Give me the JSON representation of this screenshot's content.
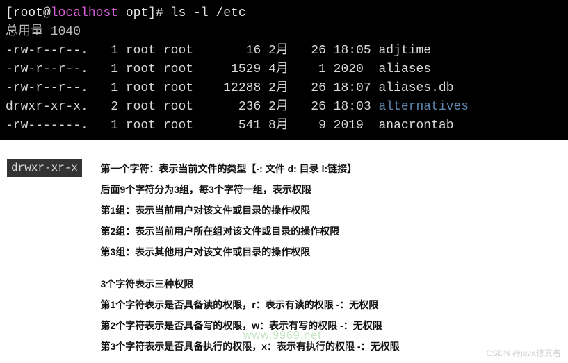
{
  "terminal": {
    "prompt": {
      "open": "[",
      "user": "root",
      "at": "@",
      "host": "localhost",
      "cwd": " opt",
      "close": "]#",
      "cmd": " ls -l /etc"
    },
    "total": "总用量 1040",
    "rows": [
      {
        "perm": "-rw-r--r--.",
        "links": "1",
        "owner": "root",
        "group": "root",
        "size": "16",
        "month": "2月",
        "day": "26",
        "time": "18:05",
        "name": "adjtime",
        "dir": false
      },
      {
        "perm": "-rw-r--r--.",
        "links": "1",
        "owner": "root",
        "group": "root",
        "size": "1529",
        "month": "4月",
        "day": "1",
        "time": "2020",
        "name": "aliases",
        "dir": false
      },
      {
        "perm": "-rw-r--r--.",
        "links": "1",
        "owner": "root",
        "group": "root",
        "size": "12288",
        "month": "2月",
        "day": "26",
        "time": "18:07",
        "name": "aliases.db",
        "dir": false
      },
      {
        "perm": "drwxr-xr-x.",
        "links": "2",
        "owner": "root",
        "group": "root",
        "size": "236",
        "month": "2月",
        "day": "26",
        "time": "18:03",
        "name": "alternatives",
        "dir": true
      },
      {
        "perm": "-rw-------.",
        "links": "1",
        "owner": "root",
        "group": "root",
        "size": "541",
        "month": "8月",
        "day": "9",
        "time": "2019",
        "name": "anacrontab",
        "dir": false
      }
    ]
  },
  "explain": {
    "badge": "drwxr-xr-x",
    "section1": [
      "第一个字符：表示当前文件的类型【-: 文件  d: 目录  l:链接】",
      "后面9个字符分为3组，每3个字符一组，表示权限",
      "第1组：表示当前用户对该文件或目录的操作权限",
      "第2组：表示当前用户所在组对该文件或目录的操作权限",
      "第3组：表示其他用户对该文件或目录的操作权限"
    ],
    "section2": [
      "3个字符表示三种权限",
      "第1个字符表示是否具备读的权限，r：表示有读的权限   -：无权限",
      "第2个字符表示是否具备写的权限，w：表示有写的权限   -：无权限",
      "第3个字符表示是否具备执行的权限，x：表示有执行的权限   -：无权限"
    ]
  },
  "watermark": "CSDN @java修真者",
  "green_wm": "www.9969.net"
}
